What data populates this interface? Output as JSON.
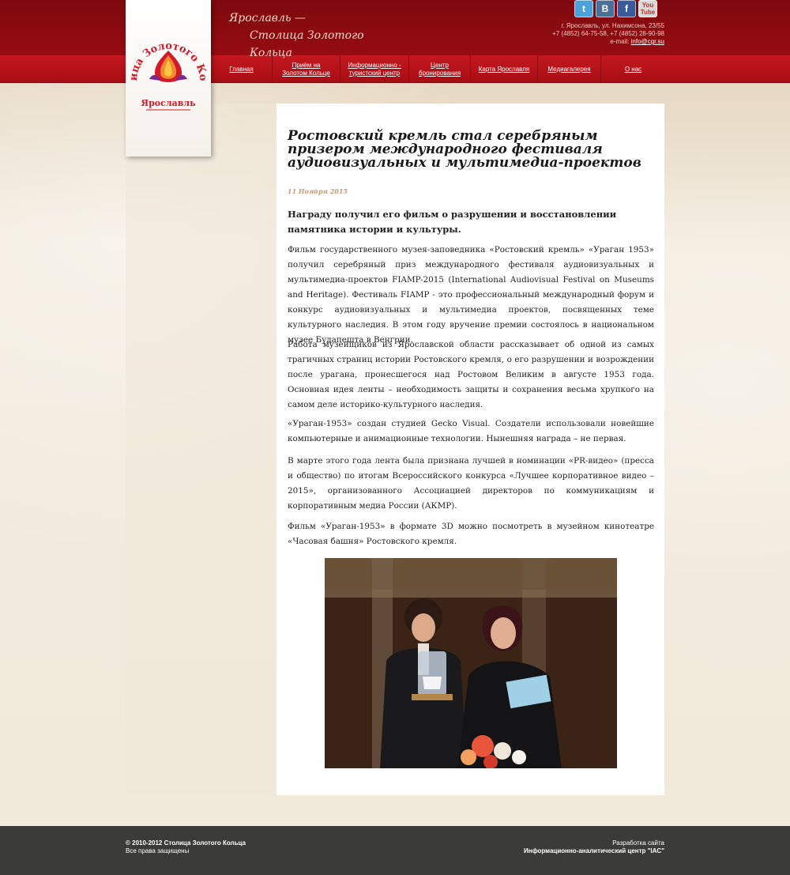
{
  "header": {
    "tagline_line1": "Ярославль —",
    "tagline_line2": "Столица Золотого Кольца",
    "logo_text_arc": "Столица Золотого Кольца",
    "logo_text_bottom": "Ярославль",
    "address": "г. Ярославль, ул. Нахимсона, 23/55",
    "phones": "+7 (4852) 64-75-58, +7 (4852) 28-90-98",
    "email_label": "e-mail:",
    "email": "info@cgr.su",
    "social": [
      {
        "name": "twitter-icon",
        "glyph": "t"
      },
      {
        "name": "vk-icon",
        "glyph": "B"
      },
      {
        "name": "facebook-icon",
        "glyph": "f"
      },
      {
        "name": "youtube-icon",
        "glyph_top": "You",
        "glyph_bottom": "Tube"
      }
    ]
  },
  "menu": [
    {
      "label_line1": "Главная",
      "label_line2": ""
    },
    {
      "label_line1": "Приём на",
      "label_line2": "Золотом Кольце"
    },
    {
      "label_line1": "Информационно -",
      "label_line2": "туристский центр"
    },
    {
      "label_line1": "Центр",
      "label_line2": "бронирования"
    },
    {
      "label_line1": "Карта Ярославля",
      "label_line2": ""
    },
    {
      "label_line1": "Медиагалерея",
      "label_line2": ""
    },
    {
      "label_line1": "О нас",
      "label_line2": ""
    }
  ],
  "article": {
    "title": "Ростовский кремль стал серебряным призером международного фестиваля аудиовизуальных и мультимедиа-проектов",
    "date": "11 Ноября 2015",
    "lead": "Награду получил его фильм о разрушении и восстановлении памятника истории и культуры.",
    "paragraphs": [
      "Фильм государственного музея-заповедника «Ростовский кремль» «Ураган 1953» получил серебряный приз  международного фестиваля аудиовизуальных и мультимедиа-проектов FIAMP-2015  (International Audiovisual Festival on Museums and Heritage). Фестиваль FIAMP - это профессиональный международный форум и конкурс аудиовизуальных и мультимедиа проектов, посвященных теме культурного наследия. В этом году вручение премии состоялось в национальном музее Будапешта в Венгрии.",
      "Работа музейщиков из Ярославской области рассказывает об одной из самых трагичных страниц истории Ростовского кремля, о его разрушении и возрождении после урагана, пронесшегося над Ростовом Великим в августе 1953 года. Основная идея ленты – необходимость защиты и сохранения весьма хрупкого на самом деле историко-культурного наследия.",
      "«Ураган-1953» создан студией Gecko Visual. Создатели использовали новейшие компьютерные и анимационные технологии. Нынешняя награда – не первая.",
      "В марте этого года лента была признана лучшей в номинации «PR-видео» (пресса и общество) по итогам Всероссийского конкурса «Лучшее корпоративное видео – 2015», организованного Ассоциацией директоров по коммуникациям и корпоративным медиа России (АКМР).",
      "Фильм «Ураган-1953» в формате 3D можно посмотреть в музейном кинотеатре «Часовая башня» Ростовского кремля."
    ]
  },
  "footer": {
    "copyright": "© 2010-2012 Столица Золотого Кольца",
    "rights": "Все права защищены",
    "dev_label": "Разработка сайта",
    "dev_name": "Информационно-аналитический центр \"IAC\""
  }
}
